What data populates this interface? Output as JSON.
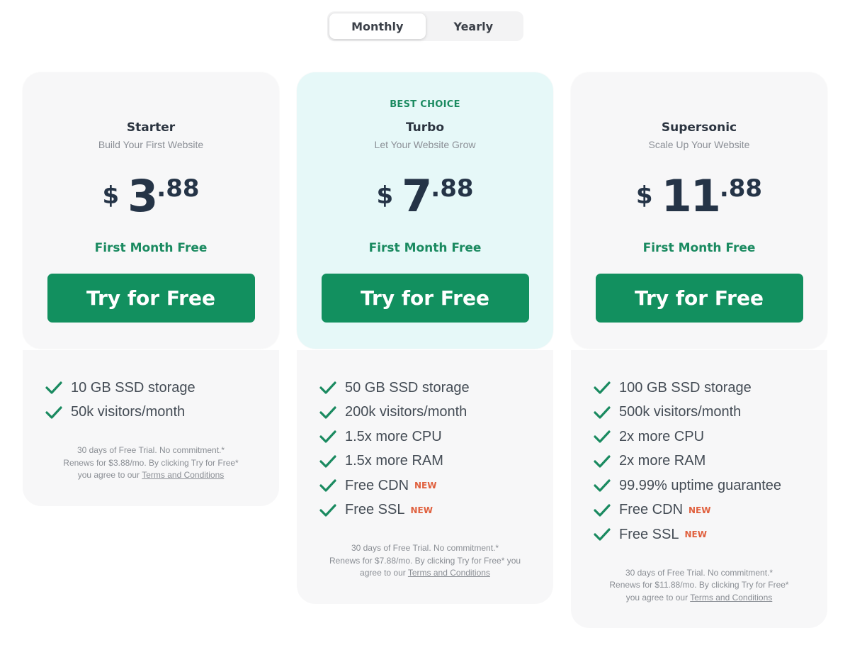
{
  "billing_toggle": {
    "options": [
      "Monthly",
      "Yearly"
    ],
    "selected": "Monthly"
  },
  "colors": {
    "accent_green": "#12905f",
    "text_green": "#1a8a60",
    "new_badge": "#e0613f",
    "featured_bg": "#e6f8f8",
    "card_bg": "#f7f7f8"
  },
  "plans": [
    {
      "badge": "",
      "name": "Starter",
      "subtitle": "Build Your First Website",
      "currency": "$",
      "price_int": "3",
      "price_dec": ".88",
      "promo": "First Month Free",
      "cta": "Try for Free",
      "features": [
        {
          "text": "10 GB SSD storage",
          "new": ""
        },
        {
          "text": "50k visitors/month",
          "new": ""
        }
      ],
      "fine_print": {
        "line1": "30 days of Free Trial. No commitment.*",
        "line2": "Renews for $3.88/mo. By clicking Try for Free*",
        "line3": "you agree to our ",
        "link": "Terms and Conditions"
      }
    },
    {
      "badge": "BEST CHOICE",
      "name": "Turbo",
      "subtitle": "Let Your Website Grow",
      "currency": "$",
      "price_int": "7",
      "price_dec": ".88",
      "promo": "First Month Free",
      "cta": "Try for Free",
      "features": [
        {
          "text": "50 GB SSD storage",
          "new": ""
        },
        {
          "text": "200k visitors/month",
          "new": ""
        },
        {
          "text": "1.5x more CPU",
          "new": ""
        },
        {
          "text": "1.5x more RAM",
          "new": ""
        },
        {
          "text": "Free CDN",
          "new": "NEW"
        },
        {
          "text": "Free SSL",
          "new": "NEW"
        }
      ],
      "fine_print": {
        "line1": "30 days of Free Trial. No commitment.*",
        "line2": "Renews for $7.88/mo. By clicking Try for Free* you",
        "line3": "agree to our ",
        "link": "Terms and Conditions"
      }
    },
    {
      "badge": "",
      "name": "Supersonic",
      "subtitle": "Scale Up Your Website",
      "currency": "$",
      "price_int": "11",
      "price_dec": ".88",
      "promo": "First Month Free",
      "cta": "Try for Free",
      "features": [
        {
          "text": "100 GB SSD storage",
          "new": ""
        },
        {
          "text": "500k visitors/month",
          "new": ""
        },
        {
          "text": "2x more CPU",
          "new": ""
        },
        {
          "text": "2x more RAM",
          "new": ""
        },
        {
          "text": "99.99% uptime guarantee",
          "new": ""
        },
        {
          "text": "Free CDN",
          "new": "NEW"
        },
        {
          "text": "Free SSL",
          "new": "NEW"
        }
      ],
      "fine_print": {
        "line1": "30 days of Free Trial. No commitment.*",
        "line2": "Renews for $11.88/mo. By clicking Try for Free*",
        "line3": "you agree to our ",
        "link": "Terms and Conditions"
      }
    }
  ]
}
